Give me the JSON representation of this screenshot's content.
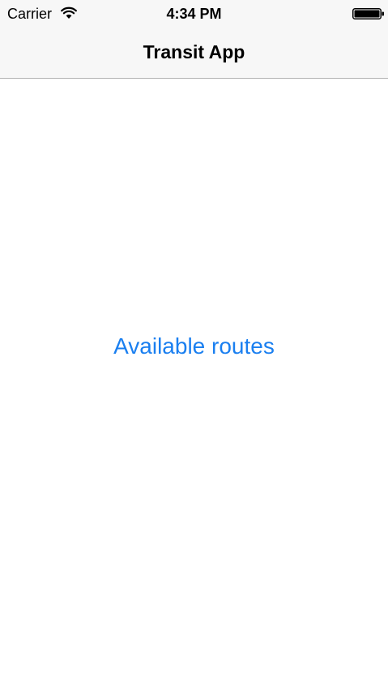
{
  "status_bar": {
    "carrier": "Carrier",
    "time": "4:34 PM",
    "wifi_icon": "wifi-icon",
    "battery_icon": "battery-full-icon"
  },
  "nav_bar": {
    "title": "Transit App"
  },
  "main": {
    "routes_button_label": "Available routes"
  },
  "colors": {
    "link_blue": "#1a7ff0",
    "nav_background": "#f7f7f7",
    "nav_border": "#b2b2b2"
  }
}
